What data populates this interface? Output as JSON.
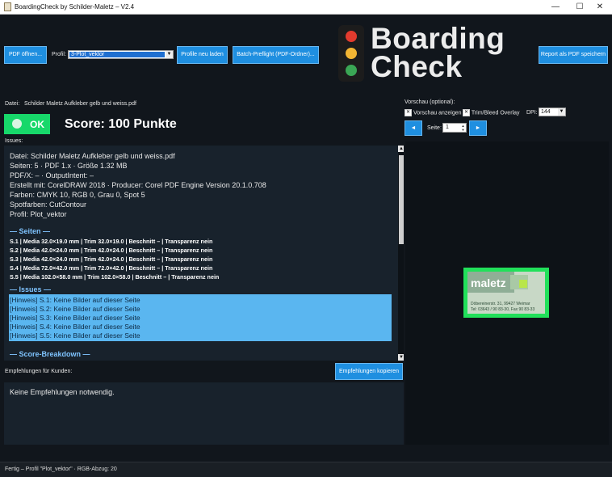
{
  "window": {
    "title": "BoardingCheck by Schilder-Maletz – V2.4",
    "min": "—",
    "max": "☐",
    "close": "✕"
  },
  "toolbar": {
    "open_label": "PDF öffnen...",
    "profile_label": "Profil:",
    "profile_value": "3-Plot_vektor",
    "reload_label": "Profile neu laden",
    "batch_label": "Batch-Preflight (PDF-Ordner)...",
    "export_label": "Report als PDF speichern"
  },
  "logo": {
    "line1": "Boarding",
    "line2": "Check",
    "lamp_colors": [
      "#e23b2e",
      "#f2b533",
      "#3aa655"
    ]
  },
  "file": {
    "label": "Datei:",
    "name": "Schilder Maletz Aufkleber gelb und weiss.pdf"
  },
  "status": {
    "badge": "OK",
    "score": "Score: 100 Punkte",
    "color": "#17d86a"
  },
  "issues_label": "Issues:",
  "report": {
    "info": [
      "Datei: Schilder Maletz Aufkleber gelb und weiss.pdf",
      "Seiten: 5 · PDF 1.x · Größe 1.32 MB",
      "PDF/X: – · OutputIntent: –",
      "Erstellt mit: CorelDRAW 2018 · Producer: Corel PDF Engine Version 20.1.0.708",
      "Farben: CMYK 10, RGB 0, Grau 0, Spot 5",
      "Spotfarben: CutContour",
      "Profil: Plot_vektor"
    ],
    "pages_heading": "— Seiten —",
    "pages": [
      "S.1 | Media 32.0×19.0 mm | Trim 32.0×19.0 | Beschnitt – | Transparenz nein",
      "S.2 | Media 42.0×24.0 mm | Trim 42.0×24.0 | Beschnitt – | Transparenz nein",
      "S.3 | Media 42.0×24.0 mm | Trim 42.0×24.0 | Beschnitt – | Transparenz nein",
      "S.4 | Media 72.0×42.0 mm | Trim 72.0×42.0 | Beschnitt – | Transparenz nein",
      "S.5 | Media 102.0×58.0 mm | Trim 102.0×58.0 | Beschnitt – | Transparenz nein"
    ],
    "issues_heading": "— Issues —",
    "issues": [
      "[Hinweis] S.1: Keine Bilder auf dieser Seite",
      "[Hinweis] S.2: Keine Bilder auf dieser Seite",
      "[Hinweis] S.3: Keine Bilder auf dieser Seite",
      "[Hinweis] S.4: Keine Bilder auf dieser Seite",
      "[Hinweis] S.5: Keine Bilder auf dieser Seite"
    ],
    "score_heading": "— Score-Breakdown —"
  },
  "recommendations": {
    "label": "Empfehlungen für Kunden:",
    "copy_label": "Empfehlungen kopieren",
    "text": "Keine Empfehlungen notwendig."
  },
  "preview": {
    "optional_label": "Vorschau (optional):",
    "show_label": "Vorschau anzeigen",
    "show_checked": true,
    "trim_label": "Trim/Bleed Overlay",
    "trim_checked": true,
    "dpi_label": "DPI:",
    "dpi_value": "144",
    "prev_icon": "◄",
    "next_icon": "►",
    "page_label": "Seite:",
    "page_value": "1",
    "thumb": {
      "logo": "maletz",
      "address": "Döbereinerstr. 31, 99427 Weimar",
      "tel": "Tel: 03643 / 90 83-30, Fax 90 83-33"
    }
  },
  "statusbar": {
    "text": "Fertig – Profil \"Plot_vektor\" · RGB-Abzug: 20"
  }
}
